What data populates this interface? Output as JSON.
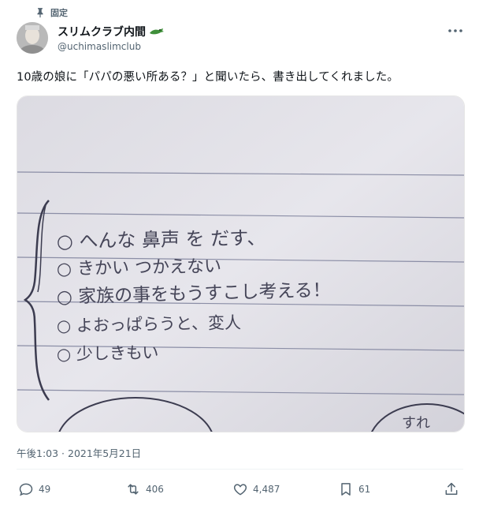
{
  "pinned_label": "固定",
  "user": {
    "display_name": "スリムクラブ内間",
    "handle": "@uchimaslimclub"
  },
  "tweet": {
    "text": "10歳の娘に「パパの悪い所ある？」と聞いたら、書き出してくれました。",
    "timestamp": "午後1:03 · 2021年5月21日"
  },
  "note_image": {
    "lines": [
      "○ へんな 鼻声 を だす、",
      "○ きかい つかえない",
      "○ 家族の事をもうすこし考える！",
      "○ よおっぱらうと、変人",
      "○ 少しきもい"
    ],
    "corner_text": "すれ"
  },
  "actions": {
    "reply_count": "49",
    "retweet_count": "406",
    "like_count": "4,487",
    "bookmark_count": "61"
  },
  "colors": {
    "text_primary": "#0f1419",
    "text_secondary": "#536471",
    "paper": "#e4e3e9",
    "ink": "#4a4a5c"
  }
}
